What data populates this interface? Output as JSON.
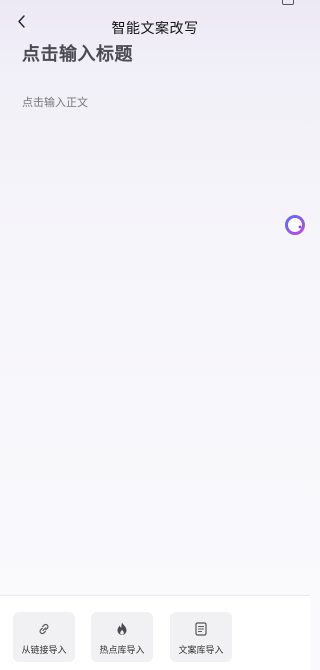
{
  "header": {
    "title": "智能文案改写"
  },
  "editor": {
    "title_placeholder": "点击输入标题",
    "body_placeholder": "点击输入正文"
  },
  "bottom_bar": {
    "buttons": [
      {
        "label": "从链接导入",
        "icon": "link-icon"
      },
      {
        "label": "热点库导入",
        "icon": "flame-icon"
      },
      {
        "label": "文案库导入",
        "icon": "document-icon"
      }
    ]
  },
  "colors": {
    "accent_ring_start": "#5b6cff",
    "accent_ring_end": "#c04ad6",
    "button_bg": "#f1f1f4"
  }
}
